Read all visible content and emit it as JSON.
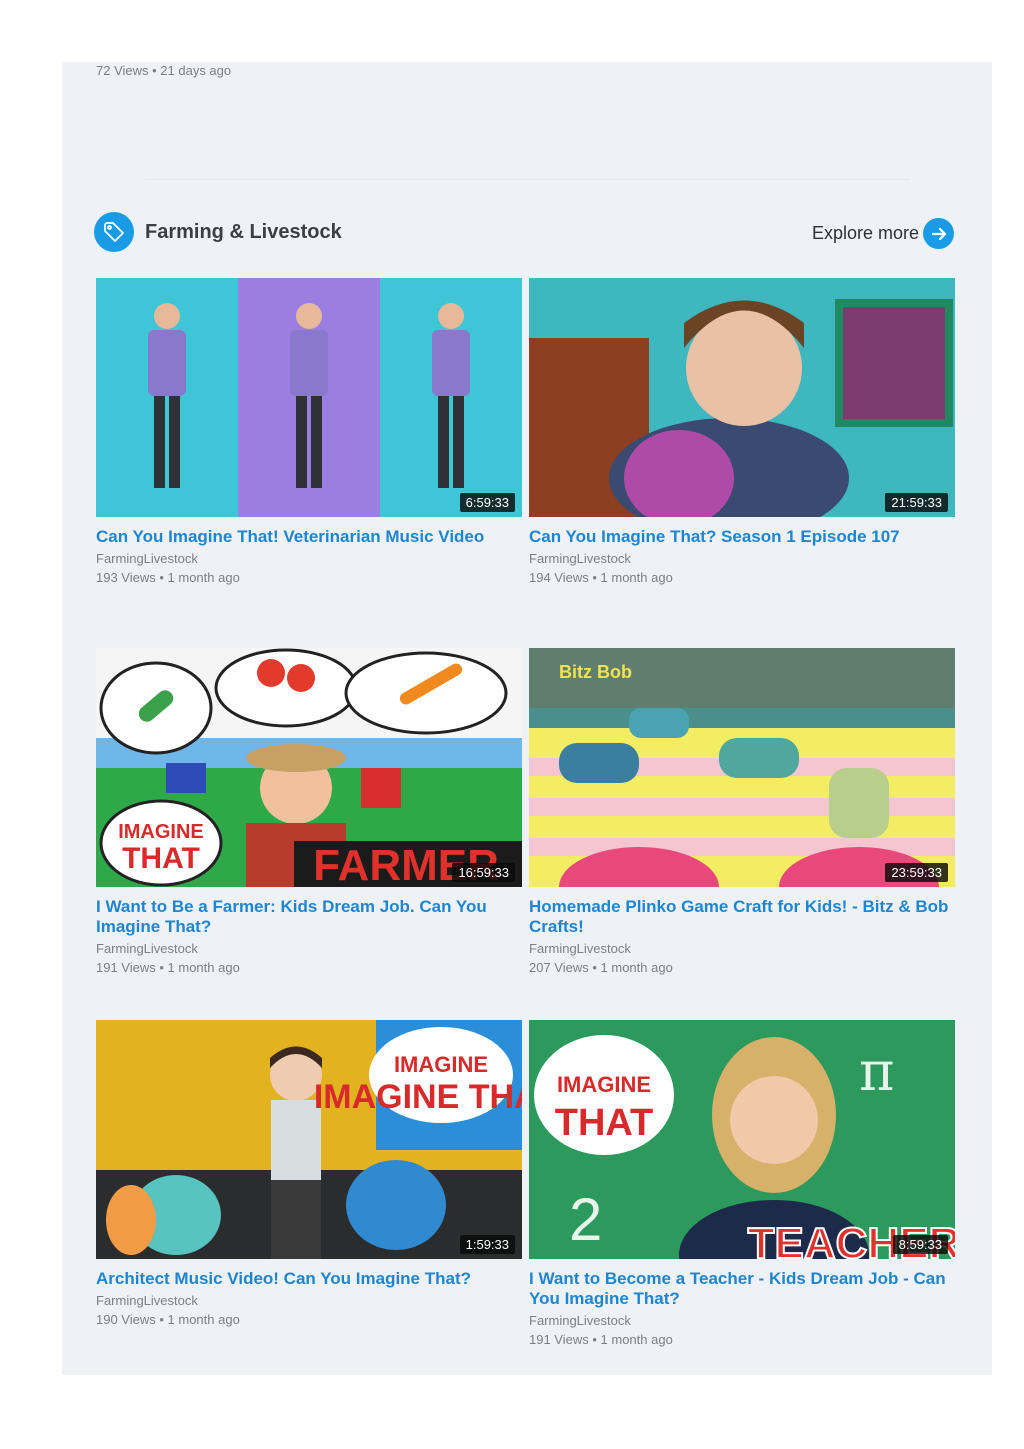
{
  "previous": {
    "meta": "72 Views • 21 days ago"
  },
  "section": {
    "title": "Farming & Livestock",
    "explore_label": "Explore more",
    "accent": "#1a9be6"
  },
  "videos": [
    {
      "title": "Can You Imagine That! Veterinarian Music Video",
      "channel": "FarmingLivestock",
      "meta": "193 Views • 1 month ago",
      "duration": "6:59:33"
    },
    {
      "title": "Can You Imagine That? Season 1 Episode 107",
      "channel": "FarmingLivestock",
      "meta": "194 Views • 1 month ago",
      "duration": "21:59:33"
    },
    {
      "title": "I Want to Be a Farmer: Kids Dream Job. Can You Imagine That?",
      "channel": "FarmingLivestock",
      "meta": "191 Views • 1 month ago",
      "duration": "16:59:33",
      "thumb_text": "FARMER"
    },
    {
      "title": "Homemade Plinko Game Craft for Kids! - Bitz & Bob Crafts!",
      "channel": "FarmingLivestock",
      "meta": "207 Views • 1 month ago",
      "duration": "23:59:33",
      "thumb_text": "Bitz Bob"
    },
    {
      "title": "Architect Music Video! Can You Imagine That?",
      "channel": "FarmingLivestock",
      "meta": "190 Views • 1 month ago",
      "duration": "1:59:33",
      "thumb_text": "IMAGINE THAT!"
    },
    {
      "title": "I Want to Become a Teacher - Kids Dream Job - Can You Imagine That?",
      "channel": "FarmingLivestock",
      "meta": "191 Views • 1 month ago",
      "duration": "8:59:33",
      "thumb_text": "TEACHER"
    }
  ]
}
